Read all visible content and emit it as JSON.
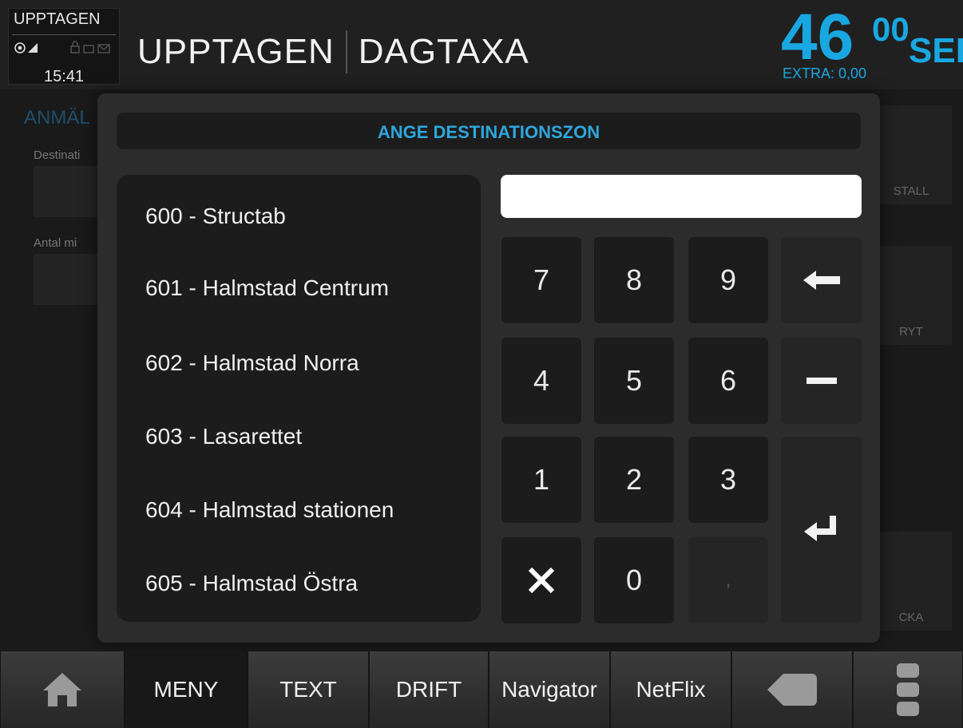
{
  "status": {
    "label": "UPPTAGEN",
    "time": "15:41",
    "icons": [
      "gps-icon",
      "signal-icon",
      "lock-icon",
      "card-icon",
      "mail-icon"
    ]
  },
  "header": {
    "status_text": "UPPTAGEN",
    "tariff": "DAGTAXA"
  },
  "fare": {
    "integer": "46",
    "decimals": "00",
    "currency": "SEK",
    "extra": "EXTRA: 0,00",
    "color": "#19a7e1"
  },
  "background": {
    "title": "ANMÄL",
    "destination_label": "Destinati",
    "minutes_label": "Antal mi",
    "side_buttons": [
      "STALL",
      "RYT",
      "CKA"
    ]
  },
  "modal": {
    "title": "ANGE DESTINATIONSZON",
    "input_value": "",
    "zones": [
      "600 - Structab",
      "601 - Halmstad Centrum",
      "602 - Halmstad Norra",
      "603 - Lasarettet",
      "604 - Halmstad stationen",
      "605 - Halmstad Östra"
    ],
    "keys": {
      "k7": "7",
      "k8": "8",
      "k9": "9",
      "k4": "4",
      "k5": "5",
      "k6": "6",
      "k1": "1",
      "k2": "2",
      "k3": "3",
      "k0": "0",
      "comma": ",",
      "backspace_icon": "arrow-left-icon",
      "minus_icon": "minus-icon",
      "clear_icon": "close-icon",
      "enter_icon": "enter-icon"
    }
  },
  "nav": {
    "home_icon": "home-icon",
    "items": [
      "MENY",
      "TEXT",
      "DRIFT",
      "Navigator",
      "NetFlix"
    ],
    "back_icon": "back-icon",
    "more_icon": "more-icon"
  }
}
